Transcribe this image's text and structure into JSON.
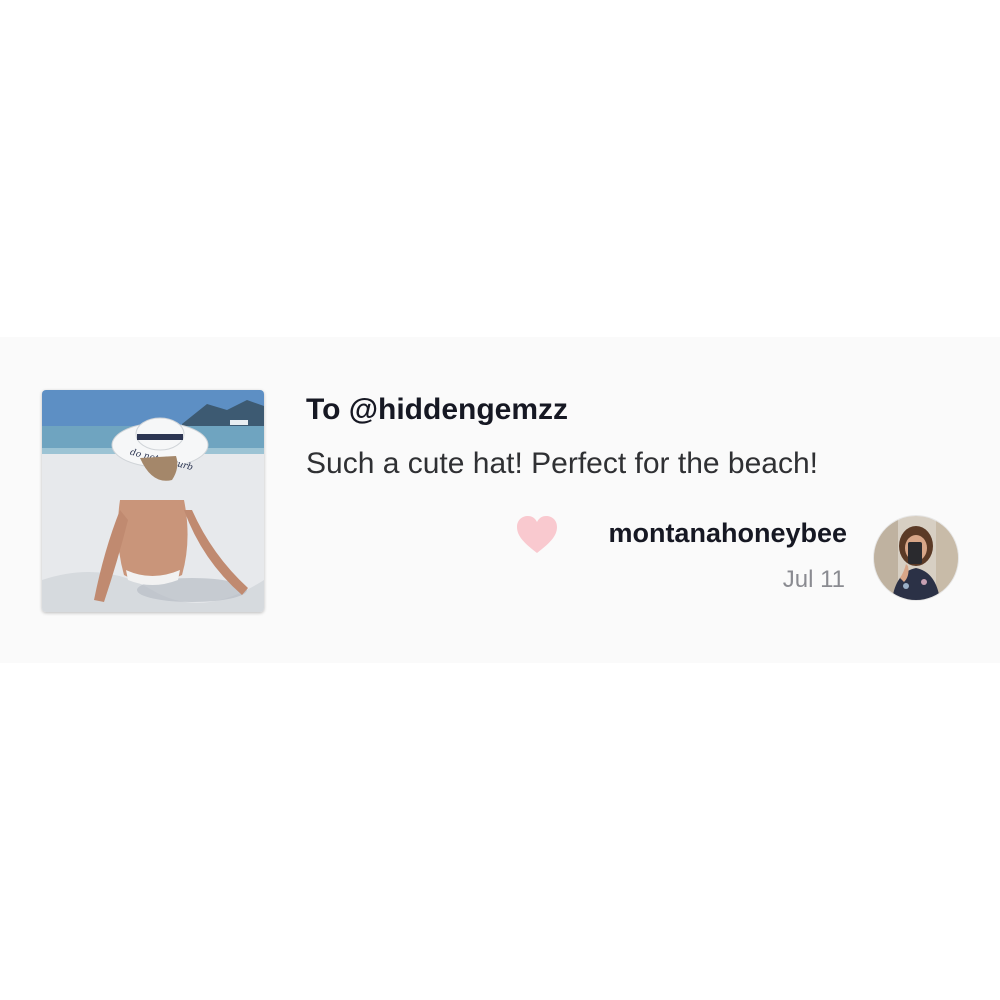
{
  "notification": {
    "to_text": "To @hiddengemzz",
    "comment_text": "Such a cute hat! Perfect for the beach!",
    "liked_by": "montanahoneybee",
    "date": "Jul 11",
    "hat_text": "do not disturb",
    "icons": {
      "like": "heart-icon"
    },
    "colors": {
      "heart": "#f9c9cf",
      "primary_text": "#161823",
      "secondary_text": "#8a8b91",
      "card_background": "#fafafa"
    }
  }
}
